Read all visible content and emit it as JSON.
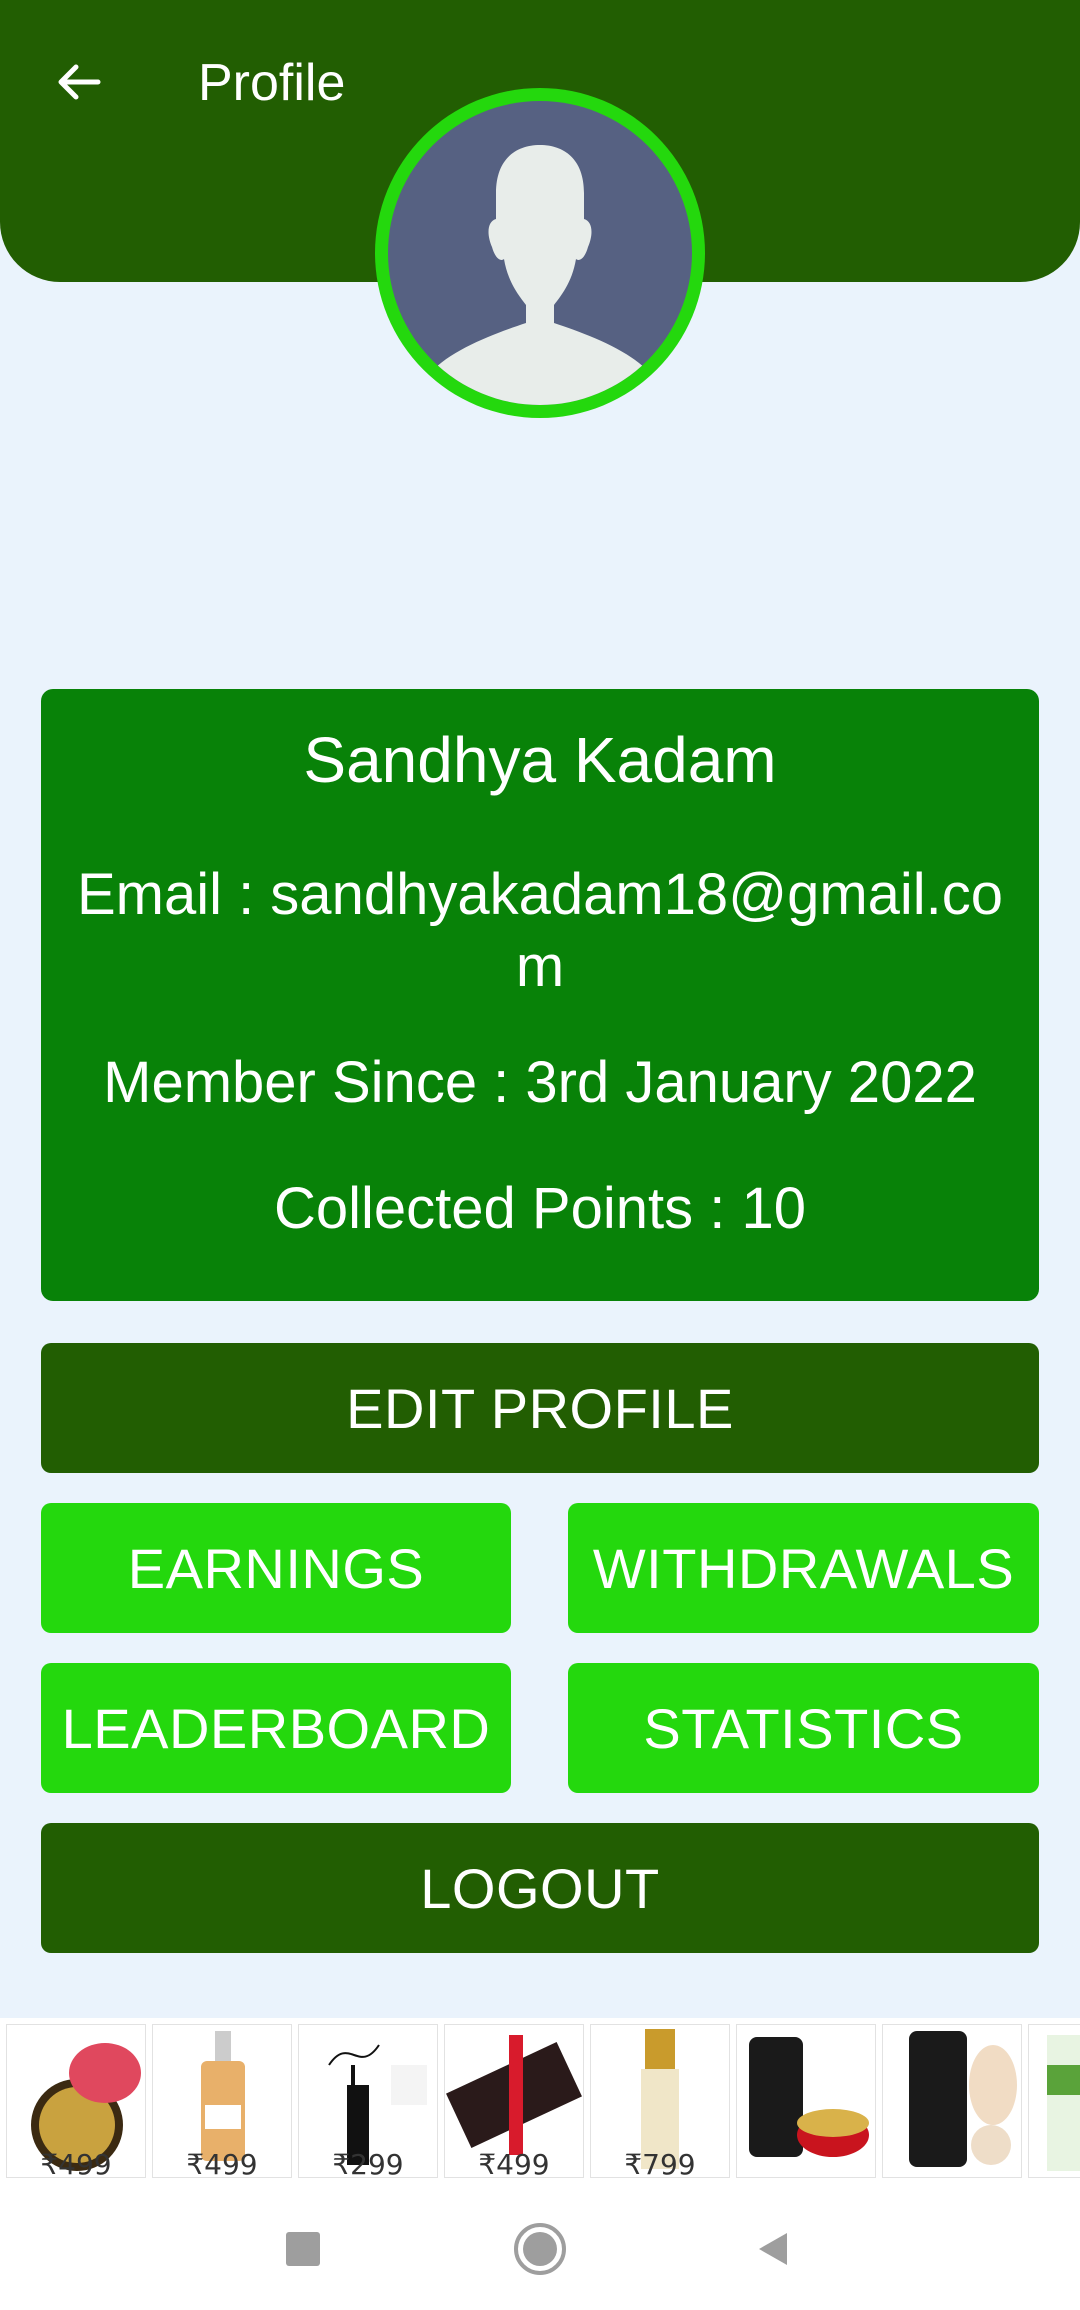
{
  "header": {
    "title": "Profile"
  },
  "profile": {
    "name": "Sandhya Kadam",
    "email_line": "Email : sandhyakadam18@gmail.com",
    "member_since": "Member Since : 3rd January 2022",
    "points": "Collected Points : 10"
  },
  "buttons": {
    "edit_profile": "EDIT PROFILE",
    "earnings": "EARNINGS",
    "withdrawals": "WITHDRAWALS",
    "leaderboard": "LEADERBOARD",
    "statistics": "STATISTICS",
    "logout": "LOGOUT"
  },
  "products": [
    {
      "price": "₹499"
    },
    {
      "price": "₹499"
    },
    {
      "price": "₹299"
    },
    {
      "price": "₹499"
    },
    {
      "price": "₹799"
    },
    {
      "price": ""
    },
    {
      "price": ""
    },
    {
      "price": ""
    }
  ],
  "colors": {
    "header": "#225E02",
    "card": "#088208",
    "accent": "#24D80D",
    "background": "#EAF3FC"
  }
}
